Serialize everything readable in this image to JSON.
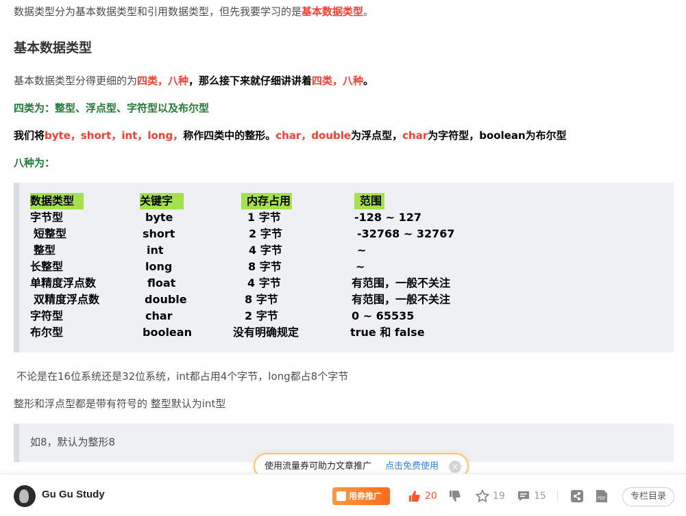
{
  "intro": {
    "prefix": "数据类型分为基本数据类型和引用数据类型，但先我要学习的是",
    "highlight": "基本数据类型",
    "suffix": "。"
  },
  "heading_basic": "基本数据类型",
  "split_sentence": {
    "a": "基本数据类型分得更细的为",
    "b": "四类，八种",
    "c": "，那么接下来就仔细讲讲着",
    "d": "四类，八种",
    "e": "。"
  },
  "four_kinds": "四类为：整型、浮点型、字符型以及布尔型",
  "int_sentence": {
    "a": "我们将",
    "b": "byte，short，int，long，",
    "c": "称作四类中的整形。",
    "d": "char，double",
    "e": "为浮点型，",
    "f": "char",
    "g": "为字符型，boolean为布尔型"
  },
  "eight_kinds": "八种为：",
  "type_table": {
    "headers": [
      "数据类型",
      "关键字",
      "内存占用",
      "范围"
    ],
    "rows": [
      [
        "字节型",
        "byte",
        "1 字节",
        "-128 ~ 127"
      ],
      [
        "短整型",
        "short",
        "2 字节",
        "-32768 ~ 32767"
      ],
      [
        "整型",
        "int",
        "4 字节",
        "~"
      ],
      [
        "长整型",
        "long",
        "8 字节",
        "~"
      ],
      [
        "单精度浮点数",
        "float",
        "4 字节",
        "有范围，一般不关注"
      ],
      [
        "双精度浮点数",
        "double",
        "8 字节",
        "有范围，一般不关注"
      ],
      [
        "字符型",
        "char",
        "2 字节",
        "0 ~ 65535"
      ],
      [
        "布尔型",
        "boolean",
        "没有明确规定",
        "true 和 false"
      ]
    ]
  },
  "bits_note": "不论是在16位系统还是32位系统，int都占用4个字节，long都占8个字节",
  "signed_note": "整形和浮点型都是带有符号的 整型默认为int型",
  "quote_note": "如8，默认为整形8",
  "coupon": {
    "text": "使用流量券可助力文章推广",
    "link": "点击免费使用",
    "close": "×"
  },
  "toolbar": {
    "author": "Gu Gu Study",
    "promo": "用券推广",
    "likes": "20",
    "favorites": "19",
    "comments": "15",
    "toc": "专栏目录"
  },
  "colors": {
    "accent_red": "#fc3b2f",
    "green": "#1f7a33",
    "header_highlight": "#a4e14b",
    "link_blue": "#3680d8"
  }
}
